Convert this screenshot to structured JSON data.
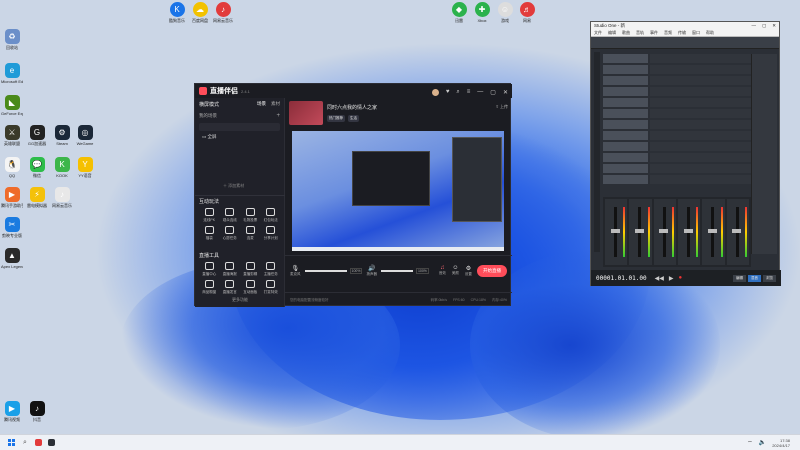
{
  "desktop": {
    "icons": [
      {
        "label": "回收站",
        "icon": "recycle-bin-icon",
        "color": "#6b8fc9",
        "glyph": "♻"
      },
      {
        "label": "Microsoft Edge",
        "icon": "edge-icon",
        "color": "#1f9bd8",
        "glyph": "e"
      },
      {
        "label": "GeForce Experience",
        "icon": "nvidia-icon",
        "color": "#4a8a1a",
        "glyph": "◣"
      },
      {
        "label": "英雄联盟",
        "icon": "lol-icon",
        "color": "#3a3a2a",
        "glyph": "⚔"
      },
      {
        "label": "GG加速器",
        "icon": "gg-icon",
        "color": "#222",
        "glyph": "G"
      },
      {
        "label": "Steam",
        "icon": "steam-icon",
        "color": "#1b2838",
        "glyph": "⚙"
      },
      {
        "label": "WeGame",
        "icon": "wegame-icon",
        "color": "#1b2838",
        "glyph": "◎"
      },
      {
        "label": "QQ",
        "icon": "qq-icon",
        "color": "#f4f4f4",
        "glyph": "🐧"
      },
      {
        "label": "微信",
        "icon": "wechat-icon",
        "color": "#2dbd4a",
        "glyph": "💬"
      },
      {
        "label": "KOOK",
        "icon": "kook-icon",
        "color": "#3cb64a",
        "glyph": "K"
      },
      {
        "label": "YY语音",
        "icon": "yy-icon",
        "color": "#f5c000",
        "glyph": "Y"
      },
      {
        "label": "腾讯手游助手",
        "icon": "tencent-icon",
        "color": "#ef6b2a",
        "glyph": "▶"
      },
      {
        "label": "雷电模拟器",
        "icon": "ld-icon",
        "color": "#f4c10a",
        "glyph": "⚡"
      },
      {
        "label": "网易云音乐",
        "icon": "cloudmusic-icon",
        "color": "#e8e8e8",
        "glyph": "♪"
      },
      {
        "label": "剪映专业版",
        "icon": "jianying-icon",
        "color": "#1a7be0",
        "glyph": "✂"
      },
      {
        "label": "Apex Legends",
        "icon": "apex-icon",
        "color": "#2a2a2a",
        "glyph": "▲"
      },
      {
        "label": "腾讯视频",
        "icon": "tencent-video-icon",
        "color": "#1aa0e8",
        "glyph": "▶"
      },
      {
        "label": "抖音",
        "icon": "douyin-icon",
        "color": "#111",
        "glyph": "♪"
      }
    ],
    "top_icons": [
      {
        "label": "酷狗音乐",
        "icon": "kugou-icon",
        "color": "#1a74e8",
        "glyph": "K"
      },
      {
        "label": "百度网盘",
        "icon": "baidu-pan-icon",
        "color": "#f2c200",
        "glyph": "☁"
      },
      {
        "label": "网易云音乐",
        "icon": "netease-icon",
        "color": "#e23b3b",
        "glyph": "♪"
      },
      {
        "label": "迅雷",
        "icon": "xunlei-icon",
        "color": "#2bb24c",
        "glyph": "◆"
      },
      {
        "label": "Xbox",
        "icon": "xbox-icon",
        "color": "#2bb24c",
        "glyph": "✚"
      },
      {
        "label": "游戏",
        "icon": "game-icon",
        "color": "#ddd",
        "glyph": "☺"
      },
      {
        "label": "网易",
        "icon": "netease2-icon",
        "color": "#e23b3b",
        "glyph": "♬"
      }
    ]
  },
  "live": {
    "app_name": "直播伴侣",
    "version": "2.4.1",
    "mode_label": "横屏模式",
    "tab_scene": "场景",
    "tab_record": "素材",
    "scene_title": "我的场景",
    "scene_item": "全屏",
    "add_material": "添加素材",
    "room_title": "同时六点我的情人之家",
    "room_tags": [
      "热门推荐",
      "生活"
    ],
    "header_right": "上传",
    "interaction_section": "互动玩法",
    "interaction_tools": [
      "连线PK",
      "观众连线",
      "礼物投票",
      "红包玩法",
      "福袋",
      "心愿任务",
      "连麦",
      "分享计划"
    ],
    "live_tools_section": "直播工具",
    "live_tools": [
      "直播中心",
      "直播海报",
      "直播剪辑",
      "主播任务",
      "商品橱窗",
      "直播发言",
      "互动面板",
      "打赏特效"
    ],
    "more_label": "更多功能",
    "mic_label": "麦克风",
    "mic_value": "100%",
    "speaker_label": "扬声器",
    "speaker_value": "100%",
    "action_labels": [
      "音效",
      "美颜",
      "设置"
    ],
    "start_button": "开始直播",
    "status_hint": "您的电脑配置流畅度较好",
    "status_bits": [
      "码率:0kb/s",
      "FPS:60",
      "CPU:18%",
      "内存:40%"
    ]
  },
  "studio": {
    "title": "Studio One - 新",
    "menus": [
      "文件",
      "编辑",
      "歌曲",
      "音轨",
      "事件",
      "音频",
      "传输",
      "窗口",
      "帮助"
    ],
    "timecode": "00001.01.01.00",
    "buttons": [
      "编辑",
      "混音",
      "浏览"
    ]
  },
  "taskbar": {
    "time": "17:38",
    "date": "2024/4/17"
  }
}
